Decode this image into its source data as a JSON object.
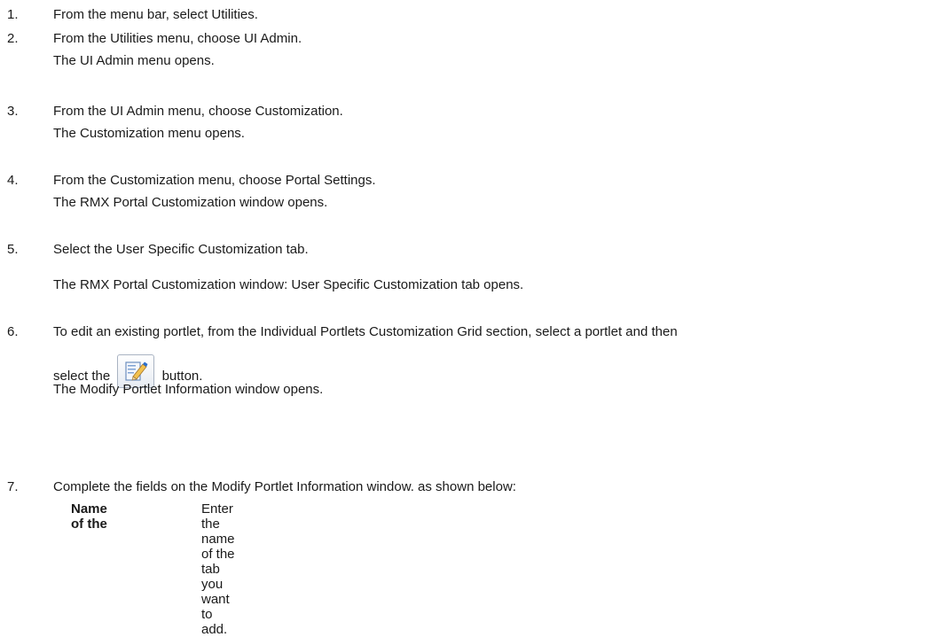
{
  "steps": [
    {
      "num": "1.",
      "text": "From the menu bar, select Utilities."
    },
    {
      "num": "2.",
      "text": "From the Utilities menu, choose UI Admin.",
      "result": "The UI Admin menu opens."
    },
    {
      "num": "3.",
      "text": "From the UI Admin menu, choose Customization.",
      "result": "The Customization menu opens."
    },
    {
      "num": "4.",
      "text": "From the Customization menu, choose Portal Settings.",
      "result": "The RMX Portal Customization window opens."
    },
    {
      "num": "5.",
      "text": "Select the User Specific Customization tab.",
      "result": "The RMX Portal Customization window: User Specific Customization tab opens."
    },
    {
      "num": "6.",
      "text": "To edit an existing portlet, from the Individual Portlets Customization Grid section, select a portlet and then",
      "text_cont_before": "select the",
      "text_cont_after": "button.",
      "result": "The Modify Portlet Information window opens."
    },
    {
      "num": "7.",
      "text": "Complete the fields on the Modify Portlet Information window. as shown below:"
    }
  ],
  "edit_icon": "edit-pencil-icon",
  "field_table": {
    "label": "Name of the",
    "description": "Enter the name of the tab you want to add."
  }
}
